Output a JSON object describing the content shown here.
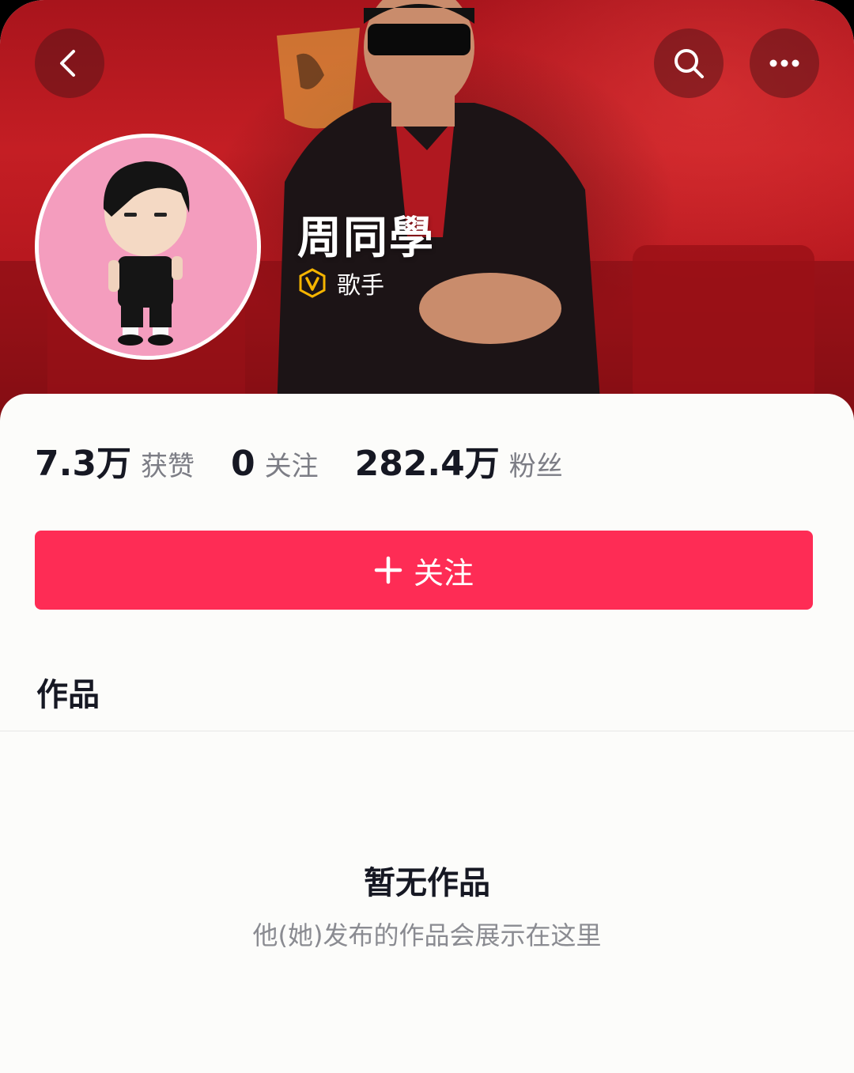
{
  "header": {
    "back_icon": "chevron-left-icon",
    "search_icon": "search-icon",
    "more_icon": "more-horizontal-icon"
  },
  "profile": {
    "name": "周同學",
    "verification_label": "歌手",
    "verification_icon": "v-badge-icon",
    "verification_color": "#f5b400"
  },
  "stats": [
    {
      "value": "7.3万",
      "label": "获赞"
    },
    {
      "value": "0",
      "label": "关注"
    },
    {
      "value": "282.4万",
      "label": "粉丝"
    }
  ],
  "follow_button": {
    "label": "关注",
    "icon": "plus-icon",
    "color": "#fe2c55"
  },
  "tabs": {
    "works": "作品"
  },
  "empty_state": {
    "title": "暂无作品",
    "subtitle": "他(她)发布的作品会展示在这里"
  }
}
